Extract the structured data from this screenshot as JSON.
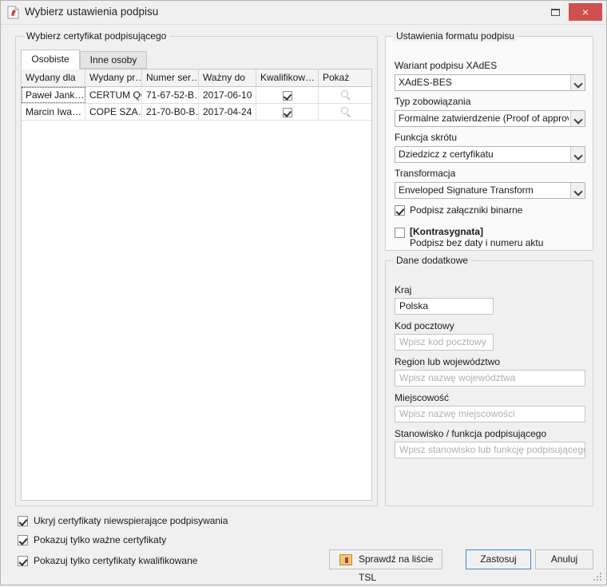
{
  "window": {
    "title": "Wybierz ustawienia podpisu",
    "icon": "signed-document-icon",
    "minimize_label": "",
    "close_label": "×"
  },
  "cert_panel": {
    "legend": "Wybierz certyfikat podpisującego",
    "tabs": [
      {
        "label": "Osobiste",
        "selected": true
      },
      {
        "label": "Inne osoby",
        "selected": false
      }
    ],
    "columns": [
      "Wydany dla",
      "Wydany pr…",
      "Numer ser…",
      "Ważny do",
      "Kwalifikow…",
      "Pokaż"
    ],
    "rows": [
      {
        "wydany_dla": "Paweł Jank…",
        "wydany_przez": "CERTUM QCA",
        "numer_seryjny": "71-67-52-B…",
        "wazny_do": "2017-06-10",
        "kwalifikowany": true,
        "pokaz": "magnifier-icon",
        "focused": true
      },
      {
        "wydany_dla": "Marcin Iwa…",
        "wydany_przez": "COPE SZA…",
        "numer_seryjny": "21-70-B0-B…",
        "wazny_do": "2017-04-24",
        "kwalifikowany": true,
        "pokaz": "magnifier-icon",
        "focused": false
      }
    ]
  },
  "format_panel": {
    "legend": "Ustawienia formatu podpisu",
    "xades_label": "Wariant podpisu XAdES",
    "xades_value": "XAdES-BES",
    "commitment_label": "Typ zobowiązania",
    "commitment_value": "Formalne zatwierdzenie (Proof of approval)",
    "hash_label": "Funkcja skrótu",
    "hash_value": "Dziedzicz z certyfikatu",
    "transform_label": "Transformacja",
    "transform_value": "Enveloped Signature Transform",
    "binary_label": "Podpisz załączniki binarne",
    "binary_checked": true,
    "counter_title": "[Kontrasygnata]",
    "counter_sub": "Podpisz bez daty i numeru aktu",
    "counter_checked": false
  },
  "extra_panel": {
    "legend": "Dane dodatkowe",
    "country_label": "Kraj",
    "country_value": "Polska",
    "postal_label": "Kod pocztowy",
    "postal_placeholder": "Wpisz kod pocztowy",
    "region_label": "Region lub województwo",
    "region_placeholder": "Wpisz nazwę województwa",
    "city_label": "Miejscowość",
    "city_placeholder": "Wpisz nazwę miejscowości",
    "role_label": "Stanowisko / funkcja podpisującego",
    "role_placeholder": "Wpisz stanowisko lub funkcję podpisującego"
  },
  "bottom": {
    "checkboxes": [
      {
        "label": "Ukryj certyfikaty niewspierające podpisywania",
        "checked": true
      },
      {
        "label": "Pokazuj tylko ważne certyfikaty",
        "checked": true
      },
      {
        "label": "Pokazuj tylko certyfikaty kwalifikowane",
        "checked": true
      }
    ],
    "tsl_button": "Sprawdź na liście TSL",
    "tsl_icon": "tsl-list-icon",
    "apply_button": "Zastosuj",
    "cancel_button": "Anuluj"
  },
  "colors": {
    "close_red": "#d05050",
    "focus_blue": "#3b8ad8",
    "window_bg": "#f0f0f0"
  }
}
